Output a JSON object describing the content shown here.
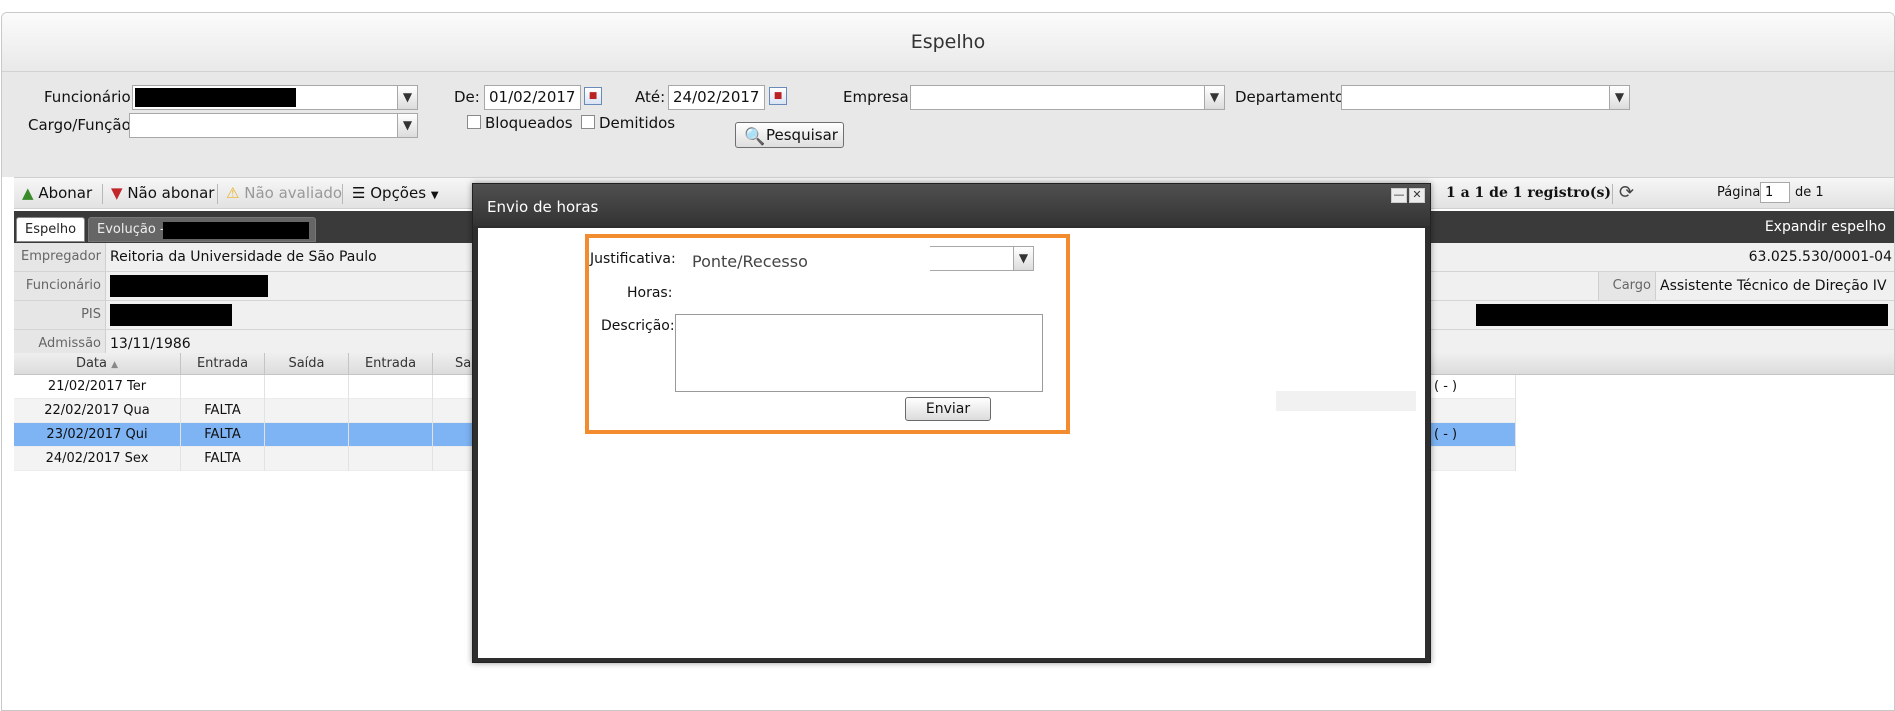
{
  "window": {
    "title": "Espelho"
  },
  "filters": {
    "funcionario_label": "Funcionário:",
    "cargo_label": "Cargo/Função:",
    "de_label": "De:",
    "de_value": "01/02/2017",
    "ate_label": "Até:",
    "ate_value": "24/02/2017",
    "empresa_label": "Empresa:",
    "departamento_label": "Departamento:",
    "bloqueados_label": "Bloqueados",
    "demitidos_label": "Demitidos",
    "pesquisar_label": "Pesquisar"
  },
  "toolbar": {
    "abonar": "Abonar",
    "nao_abonar": "Não abonar",
    "nao_avaliado": "Não avaliado",
    "opcoes": "Opções",
    "registros": "1 a 1 de 1 registro(s)",
    "pagina_label": "Página",
    "pagina_value": "1",
    "pagina_total": "de 1"
  },
  "tabs": {
    "espelho": "Espelho",
    "evolucao": "Evolução -",
    "expandir": "Expandir espelho"
  },
  "info": {
    "empregador_label": "Empregador",
    "empregador_value": "Reitoria da Universidade de São Paulo",
    "cnpj": "63.025.530/0001-04",
    "funcionario_label": "Funcionário",
    "cargo_label": "Cargo",
    "cargo_value": "Assistente Técnico de Direção IV",
    "pis_label": "PIS",
    "admissao_label": "Admissão",
    "admissao_value": "13/11/1986"
  },
  "grid": {
    "headers": [
      "Data",
      "Entrada",
      "Saída",
      "Entrada",
      "Sa"
    ],
    "rows": [
      {
        "data": "21/02/2017 Ter",
        "entrada": "",
        "tail": "( - )"
      },
      {
        "data": "22/02/2017 Qua",
        "entrada": "FALTA",
        "tail": ""
      },
      {
        "data": "23/02/2017 Qui",
        "entrada": "FALTA",
        "tail": "( - )"
      },
      {
        "data": "24/02/2017 Sex",
        "entrada": "FALTA",
        "tail": ""
      }
    ],
    "selected_row": 2
  },
  "modal": {
    "title": "Envio de horas",
    "justificativa_label": "Justificativa:",
    "justificativa_value": "Ponte/Recesso",
    "horas_label": "Horas:",
    "descricao_label": "Descrição:",
    "enviar_label": "Enviar"
  },
  "colors": {
    "highlight": "#f28c2e",
    "selected_row": "#7eb4f4",
    "modal_frame": "#2e2e2e"
  },
  "icons": {
    "abonar": "thumbs-up-icon",
    "nao_abonar": "thumbs-down-icon",
    "nao_avaliado": "warning-icon",
    "opcoes": "list-icon",
    "refresh": "refresh-icon",
    "pesquisar": "search-icon"
  }
}
